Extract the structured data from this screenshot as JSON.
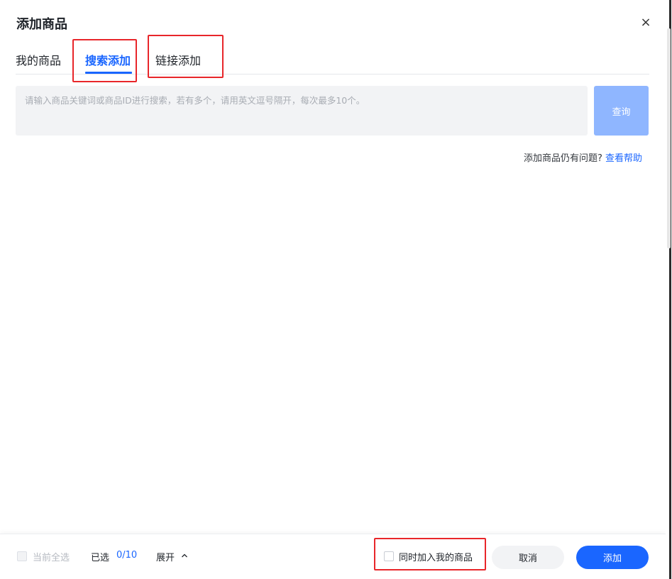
{
  "dialog": {
    "title": "添加商品",
    "close_label": "×"
  },
  "tabs": [
    {
      "label": "我的商品",
      "active": false
    },
    {
      "label": "搜索添加",
      "active": true
    },
    {
      "label": "链接添加",
      "active": false
    }
  ],
  "search": {
    "placeholder": "请输入商品关键词或商品ID进行搜索，若有多个，请用英文逗号隔开，每次最多10个。",
    "value": "",
    "query_button": "查询"
  },
  "help": {
    "text": "添加商品仍有问题?",
    "link": "查看帮助"
  },
  "footer": {
    "select_all_label": "当前全选",
    "selected_label": "已选",
    "selected_count": "0/10",
    "expand_label": "展开",
    "sync_label": "同时加入我的商品",
    "cancel_button": "取消",
    "add_button": "添加"
  },
  "icons": {
    "close": "close-icon",
    "expand": "chevron-up-icon"
  },
  "colors": {
    "accent": "#1a66ff",
    "query_button_disabled": "#8fb6ff",
    "annotation": "#e8262a"
  }
}
